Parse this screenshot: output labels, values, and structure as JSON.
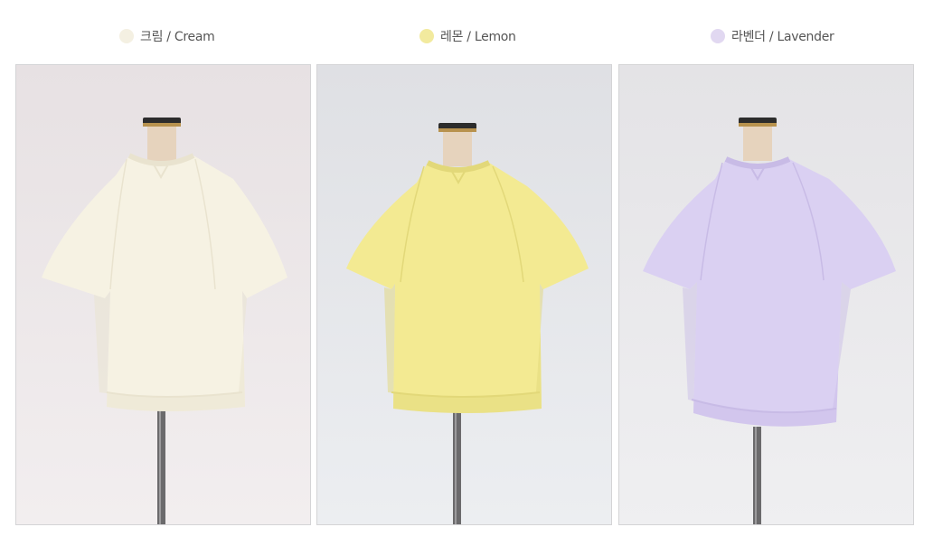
{
  "variants": [
    {
      "name": "크림 / Cream",
      "swatch": "#f4f0e2",
      "shirt": "#f6f2e3",
      "shade": "#e9e3cf",
      "bg_top": "#e7e1e3",
      "bg_bottom": "#f2eeef"
    },
    {
      "name": "레몬 / Lemon",
      "swatch": "#f2ea9e",
      "shirt": "#f3ea92",
      "shade": "#e2d879",
      "bg_top": "#dfe0e4",
      "bg_bottom": "#eceef1"
    },
    {
      "name": "라벤더 / Lavender",
      "swatch": "#e1d8f1",
      "shirt": "#dad0f2",
      "shade": "#c8bbe6",
      "bg_top": "#e4e3e6",
      "bg_bottom": "#efeff1"
    }
  ]
}
